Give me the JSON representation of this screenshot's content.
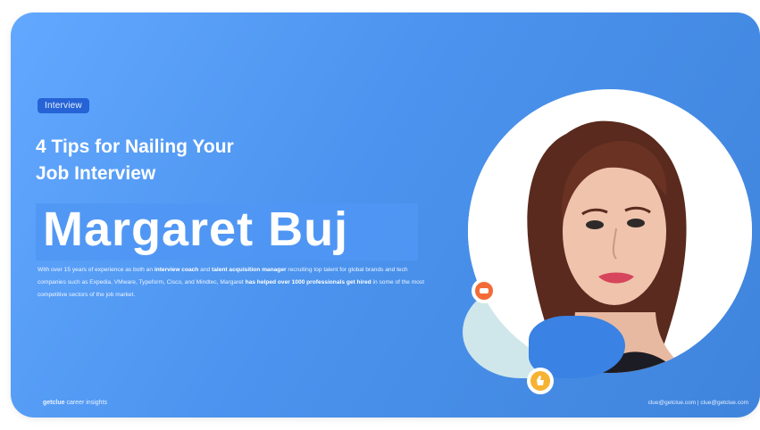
{
  "card": {
    "badge": "Interview",
    "title_line1": "4 Tips for Nailing Your",
    "title_line2": "Job Interview",
    "name": "Margaret Buj",
    "description": {
      "part1": "With over 15 years of experience as both an ",
      "bold1": "interview coach",
      "part2": " and ",
      "bold2": "talent acquisition manager",
      "part3": " recruiting top talent for global brands and tech companies such as Expedia, VMware, Typeform, Cisco, and Mindtec, Margaret ",
      "bold3": "has helped over 1000 professionals get hired",
      "part4": " in some of the most competitive sectors of the job market."
    },
    "footer_left_bold": "getclue",
    "footer_left_text": " career insights",
    "footer_right": "clue@getclue.com | clue@getclue.com"
  },
  "colors": {
    "background_start": "#63a8ff",
    "background_end": "#3f84dc",
    "badge": "#2563d6",
    "accent_red": "#f36b37",
    "accent_yellow": "#f6b332",
    "bubble_mint": "#cfe7ea"
  },
  "icons": [
    "chat-bubble-icon",
    "thumbs-up-icon"
  ]
}
